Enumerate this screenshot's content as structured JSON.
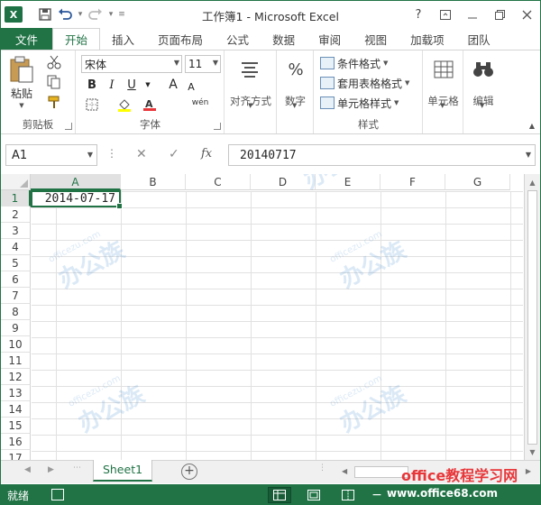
{
  "window": {
    "title": "工作簿1 - Microsoft Excel",
    "app_icon": "X",
    "help": "?",
    "buttons": [
      "ribbon-display-icon",
      "minimize-icon",
      "restore-icon",
      "close-icon"
    ]
  },
  "qat": {
    "icons": [
      "save-icon",
      "undo-icon",
      "redo-icon",
      "customize-icon"
    ]
  },
  "tabs": [
    {
      "label": "文件"
    },
    {
      "label": "开始"
    },
    {
      "label": "插入"
    },
    {
      "label": "页面布局"
    },
    {
      "label": "公式"
    },
    {
      "label": "数据"
    },
    {
      "label": "审阅"
    },
    {
      "label": "视图"
    },
    {
      "label": "加载项"
    },
    {
      "label": "团队"
    }
  ],
  "ribbon": {
    "clipboard": {
      "label": "剪贴板",
      "paste": "粘贴"
    },
    "font": {
      "label": "字体",
      "name": "宋体",
      "size": "11",
      "bold": "B",
      "italic": "I",
      "underline": "U",
      "grow": "A",
      "shrink": "A",
      "wen": "wén"
    },
    "alignment": {
      "label": "对齐方式"
    },
    "number": {
      "label": "数字",
      "symbol": "%"
    },
    "styles": {
      "label": "样式",
      "conditional": "条件格式",
      "table": "套用表格格式",
      "cell_styles": "单元格样式"
    },
    "cells": {
      "label": "单元格"
    },
    "editing": {
      "label": "编辑"
    }
  },
  "formula_bar": {
    "name_box": "A1",
    "fx": "fx",
    "value": "20140717"
  },
  "sheet": {
    "columns": [
      "A",
      "B",
      "C",
      "D",
      "E",
      "F",
      "G"
    ],
    "rows": [
      "1",
      "2",
      "3",
      "4",
      "5",
      "6",
      "7",
      "8",
      "9",
      "10",
      "11",
      "12",
      "13",
      "14",
      "15",
      "16",
      "17"
    ],
    "selected_cell": "A1",
    "a1_value": "2014-07-17"
  },
  "sheet_tabs": {
    "active": "Sheet1",
    "add": "+"
  },
  "status": {
    "ready": "就绪"
  },
  "watermark": {
    "brand": "office教程学习网",
    "url": "www.office68.com",
    "site": "officezu.com",
    "logo_text": "办公族"
  },
  "accent": "#217346"
}
